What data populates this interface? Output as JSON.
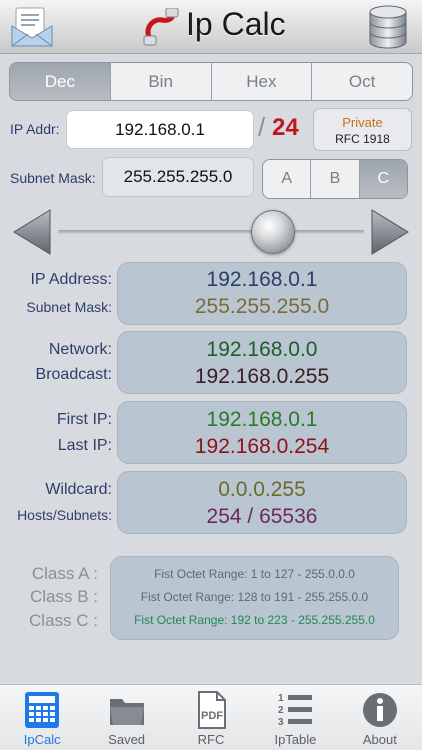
{
  "header": {
    "title": "Ip Calc"
  },
  "base_tabs": [
    {
      "label": "Dec",
      "active": true
    },
    {
      "label": "Bin",
      "active": false
    },
    {
      "label": "Hex",
      "active": false
    },
    {
      "label": "Oct",
      "active": false
    }
  ],
  "ip": {
    "label": "IP Addr:",
    "value": "192.168.0.1",
    "slash": "/",
    "prefix": "24"
  },
  "address_type": {
    "type": "Private",
    "rfc": "RFC 1918"
  },
  "mask": {
    "label": "Subnet Mask:",
    "value": "255.255.255.0"
  },
  "class_tabs": [
    {
      "label": "A",
      "active": false
    },
    {
      "label": "B",
      "active": false
    },
    {
      "label": "C",
      "active": true
    }
  ],
  "results": {
    "ip_address": {
      "label": "IP Address:",
      "value": "192.168.0.1",
      "color": "#2b3f66"
    },
    "subnet_mask": {
      "label": "Subnet Mask:",
      "value": "255.255.255.0",
      "color": "#7b6a3c"
    },
    "network": {
      "label": "Network:",
      "value": "192.168.0.0",
      "color": "#1f5c2c"
    },
    "broadcast": {
      "label": "Broadcast:",
      "value": "192.168.0.255",
      "color": "#3a1e24"
    },
    "first_ip": {
      "label": "First IP:",
      "value": "192.168.0.1",
      "color": "#2a7a2a"
    },
    "last_ip": {
      "label": "Last IP:",
      "value": "192.168.0.254",
      "color": "#8c1218"
    },
    "wildcard": {
      "label": "Wildcard:",
      "value": "0.0.0.255",
      "color": "#6b6b2a"
    },
    "hosts_subnets": {
      "label": "Hosts/Subnets:",
      "value": "254 / 65536",
      "color": "#6b2a62"
    }
  },
  "class_ranges": [
    {
      "label": "Class A :",
      "range": "Fist Octet Range: 1 to 127 - 255.0.0.0",
      "active": false
    },
    {
      "label": "Class B :",
      "range": "Fist Octet Range: 128 to 191 - 255.255.0.0",
      "active": false
    },
    {
      "label": "Class C :",
      "range": "Fist Octet Range: 192 to 223 - 255.255.255.0",
      "active": true
    }
  ],
  "tabbar": [
    {
      "label": "IpCalc",
      "icon": "calculator-icon",
      "active": true
    },
    {
      "label": "Saved",
      "icon": "folder-icon",
      "active": false
    },
    {
      "label": "RFC",
      "icon": "pdf-icon",
      "icon_text": "PDF",
      "active": false
    },
    {
      "label": "IpTable",
      "icon": "numbered-list-icon",
      "active": false
    },
    {
      "label": "About",
      "icon": "info-icon",
      "active": false
    }
  ],
  "colors": {
    "accent": "#1d79e8",
    "prefix": "#c0161a",
    "active_class": "#1f8a55"
  }
}
